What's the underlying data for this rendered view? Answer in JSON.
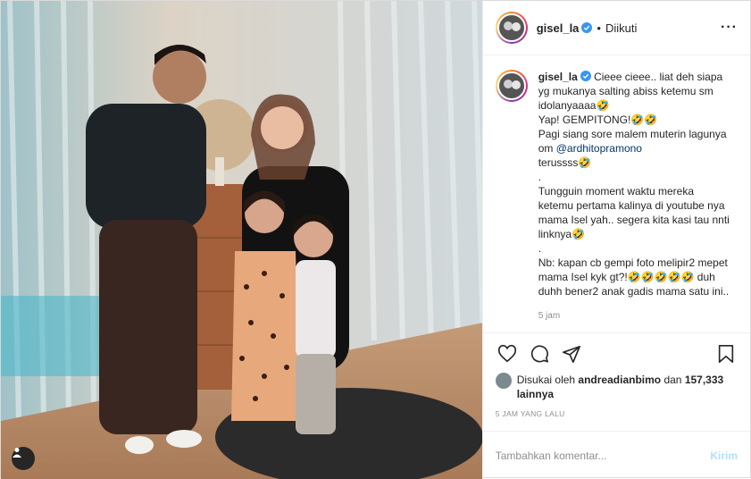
{
  "post": {
    "username": "gisel_la",
    "follow_separator": "•",
    "follow_status": "Diikuti",
    "more_icon": "more-options-icon",
    "more_label": "···"
  },
  "caption": {
    "username": "gisel_la",
    "lines": [
      "Cieee cieee.. liat deh siapa yg mukanya salting abiss ketemu sm idolanyaaaa🤣",
      "Yap! GEMPITONG!🤣🤣",
      "Pagi siang sore malem muterin lagunya om ",
      "terussss🤣",
      ".",
      "Tungguin moment waktu mereka ketemu pertama kalinya di youtube nya mama Isel yah.. segera kita kasi tau nnti linknya🤣",
      ".",
      "Nb: kapan cb gempi foto melipir2 mepet mama Isel kyk gt?!🤣🤣🤣🤣🤣 duh duhh bener2 anak gadis mama satu ini.."
    ],
    "mention": "@ardhitopramono",
    "time": "5 jam"
  },
  "actions": {
    "like_icon": "heart-icon",
    "comment_icon": "comment-icon",
    "share_icon": "share-icon",
    "save_icon": "bookmark-icon"
  },
  "likes": {
    "prefix": "Disukai oleh ",
    "user": "andreadianbimo",
    "middle": " dan ",
    "count": "157,333 lainnya"
  },
  "posted_ago": "5 JAM YANG LALU",
  "comment_input": {
    "placeholder": "Tambahkan komentar...",
    "send_label": "Kirim"
  },
  "colors": {
    "verified_blue": "#3897f0",
    "mention": "#00376b",
    "send_disabled": "#b2dffc",
    "muted": "#8e8e8e"
  }
}
